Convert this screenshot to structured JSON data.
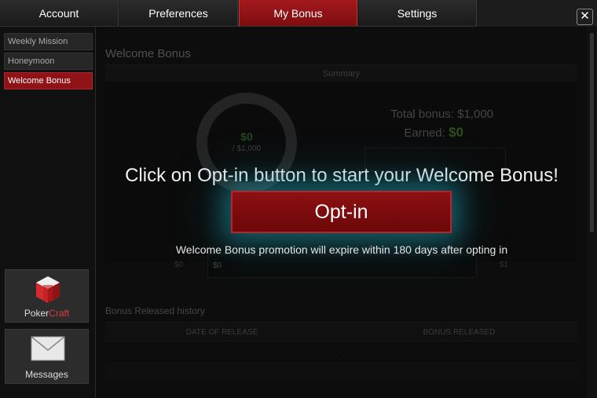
{
  "tabs": [
    {
      "label": "Account"
    },
    {
      "label": "Preferences"
    },
    {
      "label": "My Bonus"
    },
    {
      "label": "Settings"
    }
  ],
  "close_icon": "close-icon",
  "sidebar": {
    "items": [
      {
        "label": "Weekly Mission"
      },
      {
        "label": "Honeymoon"
      },
      {
        "label": "Welcome Bonus"
      }
    ],
    "pokercraft": {
      "label_main": "Poker",
      "label_accent": "Craft",
      "icon": "pokercraft-icon"
    },
    "messages": {
      "label": "Messages",
      "icon": "envelope-icon"
    }
  },
  "panel": {
    "title": "Welcome Bonus",
    "summary_label": "Summary",
    "donut": {
      "earned": "$0",
      "total": "/ $1,000"
    },
    "total_bonus": "Total bonus: $1,000",
    "earned_label": "Earned:",
    "earned_value": "$0",
    "progress": {
      "left": "$0",
      "inner": "$0",
      "right": "$1"
    }
  },
  "history": {
    "title": "Bonus Released history",
    "col_date": "DATE OF RELEASE",
    "col_bonus": "BONUS RELEASED",
    "row_placeholder": "-"
  },
  "overlay": {
    "message": "Click on Opt-in button to start your Welcome Bonus!",
    "button_label": "Opt-in",
    "expire_text": "Welcome Bonus promotion will expire within 180 days after opting in"
  },
  "colors": {
    "accent": "#8e1216",
    "earned_green": "#4f8a2e",
    "glow": "#1eaabe"
  }
}
